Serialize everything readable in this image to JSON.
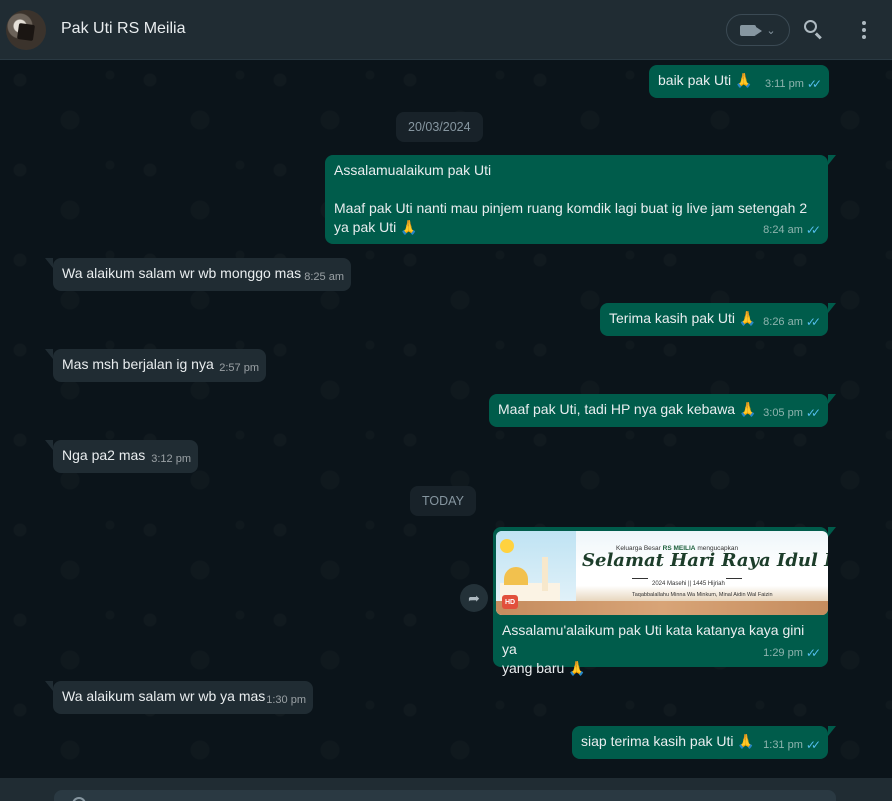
{
  "header": {
    "contact_name": "Pak Uti RS Meilia",
    "video_icon": "video-camera-icon",
    "search_icon": "search-icon",
    "menu_icon": "menu-dots-icon"
  },
  "colors": {
    "header_bg": "#202c33",
    "chat_bg": "#0b141a",
    "outgoing_bubble": "#005c4b",
    "incoming_bubble": "#202c33",
    "read_ticks": "#53bdeb"
  },
  "dates": [
    "20/03/2024",
    "TODAY"
  ],
  "messages": [
    {
      "dir": "out",
      "text": "baik pak Uti 🙏",
      "time": "3:11 pm"
    },
    {
      "dir": "out",
      "text": "Assalamualaikum pak Uti\n\nMaaf pak Uti nanti mau pinjem ruang komdik lagi buat ig live jam setengah 2\nya pak Uti 🙏",
      "time": "8:24 am"
    },
    {
      "dir": "in",
      "text": "Wa alaikum salam wr wb monggo mas",
      "time": "8:25 am"
    },
    {
      "dir": "out",
      "text": "Terima kasih pak Uti 🙏",
      "time": "8:26 am"
    },
    {
      "dir": "in",
      "text": "Mas msh berjalan ig nya",
      "time": "2:57 pm"
    },
    {
      "dir": "out",
      "text": "Maaf pak Uti, tadi HP nya gak kebawa 🙏",
      "time": "3:05 pm"
    },
    {
      "dir": "in",
      "text": "Nga pa2 mas",
      "time": "3:12 pm"
    },
    {
      "dir": "out",
      "text": "Assalamu'alaikum pak Uti kata katanya kaya gini ya\nyang baru 🙏",
      "time": "1:29 pm"
    },
    {
      "dir": "in",
      "text": "Wa alaikum salam wr wb ya mas",
      "time": "1:30 pm"
    },
    {
      "dir": "out",
      "text": "siap terima kasih pak Uti 🙏",
      "time": "1:31 pm"
    }
  ],
  "banner": {
    "top_line_prefix": "Keluarga Besar",
    "top_line_brand": "RS MEILIA",
    "top_line_suffix": "mengucapkan",
    "title": "Selamat Hari Raya Idul Fitri",
    "subtitle": "2024 Masehi || 1445 Hijriah",
    "footer": "Taqabbalallahu Minna Wa Minkum, Minal Aidin Wal Faizin",
    "badge": "HD"
  },
  "ticks": "✓✓"
}
